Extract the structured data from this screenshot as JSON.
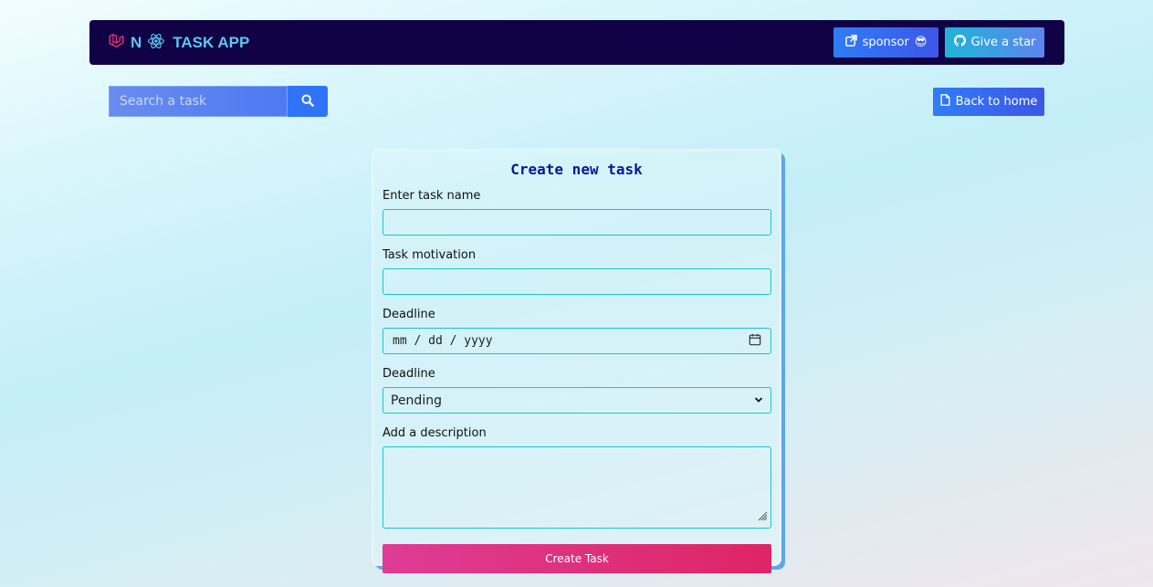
{
  "navbar": {
    "brand_letter": "N",
    "brand_title": "TASK APP",
    "sponsor_label": "sponsor",
    "star_label": "Give a star"
  },
  "search": {
    "placeholder": "Search a task",
    "value": ""
  },
  "actions": {
    "back_home_label": "Back to home"
  },
  "form": {
    "title": "Create new task",
    "task_name_label": "Enter task name",
    "task_name_value": "",
    "motivation_label": "Task motivation",
    "motivation_value": "",
    "deadline_label": "Deadline",
    "deadline_placeholder": "mm / dd / yyyy",
    "status_label": "Deadline",
    "status_value": "Pending",
    "description_label": "Add a description",
    "description_value": "",
    "submit_label": "Create Task"
  },
  "icons": {
    "brand_logos": [
      "laravel-icon",
      "react-icon"
    ],
    "sponsor_icon": "external-link-icon",
    "sponsor_emoji": "😎",
    "star_icon": "github-icon",
    "search_icon": "search-icon",
    "home_icon": "file-icon",
    "calendar_icon": "calendar-icon",
    "select_icon": "chevron-down-icon"
  },
  "colors": {
    "navbar_bg": "#110246",
    "brand_text": "#5fc6f0",
    "primary_button": "#2f7cf8",
    "star_button": "#1fb4d8",
    "form_title": "#0a1891",
    "field_border": "#1bc6c6",
    "submit_button": "#df3c95"
  }
}
